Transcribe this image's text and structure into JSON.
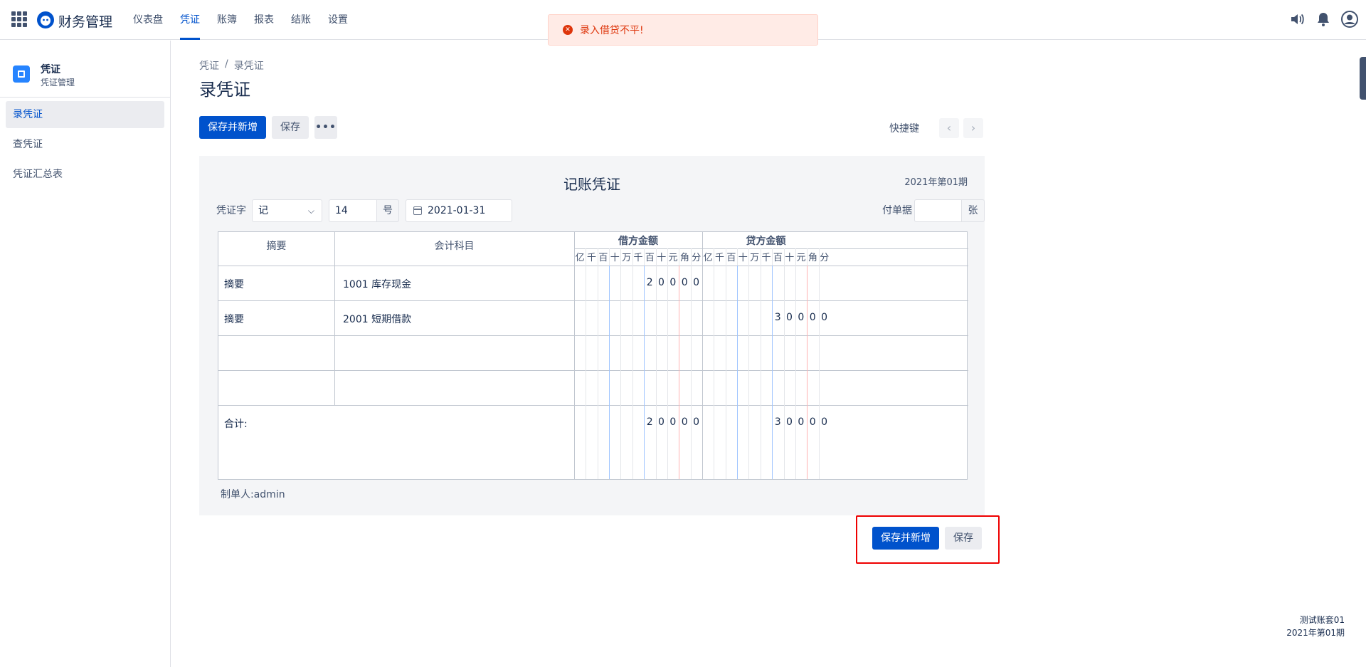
{
  "app": {
    "name": "财务管理"
  },
  "nav": [
    {
      "label": "仪表盘"
    },
    {
      "label": "凭证",
      "active": true
    },
    {
      "label": "账簿"
    },
    {
      "label": "报表"
    },
    {
      "label": "结账"
    },
    {
      "label": "设置"
    }
  ],
  "toast": {
    "message": "录入借贷不平!",
    "type": "error"
  },
  "sidebar": {
    "title": "凭证",
    "subtitle": "凭证管理",
    "items": [
      {
        "label": "录凭证",
        "active": true
      },
      {
        "label": "查凭证"
      },
      {
        "label": "凭证汇总表"
      }
    ]
  },
  "breadcrumb": [
    "凭证",
    "录凭证"
  ],
  "breadcrumb_sep": "/",
  "page_title": "录凭证",
  "toolbar": {
    "save_new": "保存并新增",
    "save": "保存",
    "more": "•••",
    "shortcut": "快捷键",
    "prev": "‹",
    "next": "›"
  },
  "voucher": {
    "title": "记账凭证",
    "period": "2021年第01期",
    "word_label": "凭证字",
    "word_value": "记",
    "number_value": "14",
    "number_suffix": "号",
    "date_value": "2021-01-31",
    "attach_label": "付单据",
    "attach_value": "",
    "attach_suffix": "张",
    "headers": {
      "summary": "摘要",
      "account": "会计科目",
      "debit": "借方金额",
      "credit": "贷方金额"
    },
    "digit_units": [
      "亿",
      "千",
      "百",
      "十",
      "万",
      "千",
      "百",
      "十",
      "元",
      "角",
      "分"
    ],
    "rows": [
      {
        "summary": "摘要",
        "account": "1001 库存现金",
        "debit": "20000",
        "credit": ""
      },
      {
        "summary": "摘要",
        "account": "2001 短期借款",
        "debit": "",
        "credit": "30000"
      },
      {
        "summary": "",
        "account": "",
        "debit": "",
        "credit": ""
      },
      {
        "summary": "",
        "account": "",
        "debit": "",
        "credit": ""
      }
    ],
    "total_label": "合计:",
    "total_debit": "20000",
    "total_credit": "30000",
    "maker": "制单人:admin"
  },
  "bottom": {
    "save_new": "保存并新增",
    "save": "保存"
  },
  "footer": {
    "account_set": "测试账套01",
    "period": "2021年第01期"
  },
  "colors": {
    "primary": "#0052cc",
    "error": "#de350b",
    "highlight_box": "#ee0000"
  }
}
